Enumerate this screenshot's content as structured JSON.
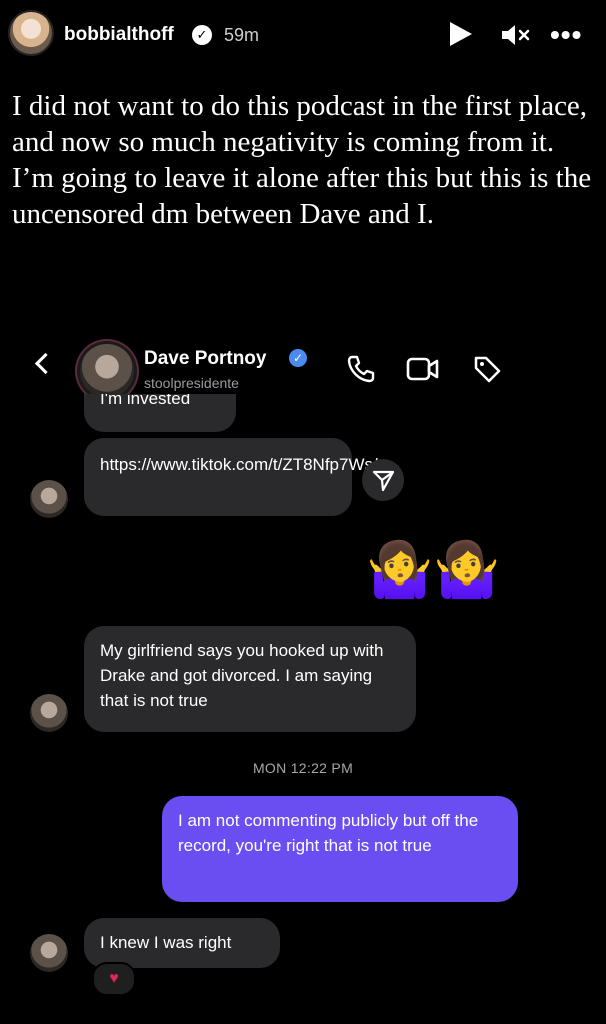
{
  "story": {
    "username": "bobbialthoff",
    "verified_glyph": "✓",
    "time": "59m",
    "caption": "I did not want to do this podcast in the first place, and now so much negativity is coming from it. I’m going to leave it alone after this but this is the uncensored dm between Dave and I."
  },
  "dm": {
    "name": "Dave Portnoy",
    "verified_glyph": "✓",
    "handle": "stoolpresidente",
    "messages": {
      "clipped": "I'm invested",
      "link": "https://www.tiktok.com/t/ZT8Nfp7Ws/",
      "emojis": "🤷‍♀️🤷‍♀️",
      "girlfriend": "My girlfriend says you hooked up with Drake and got divorced.  I am saying that is not true",
      "timestamp": "MON 12:22 PM",
      "sent": "I am not commenting publicly but off the record, you're right that is not true",
      "last": "I knew I was right",
      "reaction": "♥"
    }
  },
  "icons": [
    "play-icon",
    "mute-icon",
    "more-icon",
    "back-icon",
    "phone-icon",
    "video-icon",
    "tag-icon",
    "share-icon",
    "heart-icon"
  ],
  "colors": {
    "sent_bubble": "#6b4ef2",
    "received_bubble": "#2a2a2c",
    "verified_blue": "#4b8af0"
  }
}
